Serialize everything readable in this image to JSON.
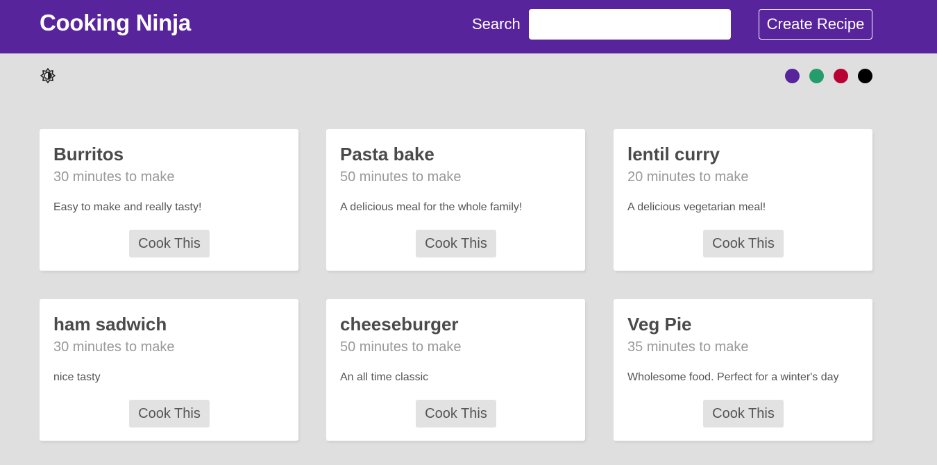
{
  "navbar": {
    "brand": "Cooking Ninja",
    "search_label": "Search",
    "search_value": "",
    "create_label": "Create Recipe"
  },
  "theme": {
    "mode_icon": "brightness-half-icon",
    "swatches": [
      {
        "name": "purple",
        "color": "#58249c"
      },
      {
        "name": "green",
        "color": "#249c6b"
      },
      {
        "name": "red",
        "color": "#b70233"
      },
      {
        "name": "black",
        "color": "#000000"
      }
    ]
  },
  "recipes": [
    {
      "title": "Burritos",
      "time": "30 minutes to make",
      "description": "Easy to make and really tasty!",
      "action": "Cook This"
    },
    {
      "title": "Pasta bake",
      "time": "50 minutes to make",
      "description": "A delicious meal for the whole family!",
      "action": "Cook This"
    },
    {
      "title": "lentil curry",
      "time": "20 minutes to make",
      "description": "A delicious vegetarian meal!",
      "action": "Cook This"
    },
    {
      "title": "ham sadwich",
      "time": "30 minutes to make",
      "description": "nice tasty",
      "action": "Cook This"
    },
    {
      "title": "cheeseburger",
      "time": "50 minutes to make",
      "description": "An all time classic",
      "action": "Cook This"
    },
    {
      "title": "Veg Pie",
      "time": "35 minutes to make",
      "description": "Wholesome food. Perfect for a winter's day",
      "action": "Cook This"
    }
  ]
}
